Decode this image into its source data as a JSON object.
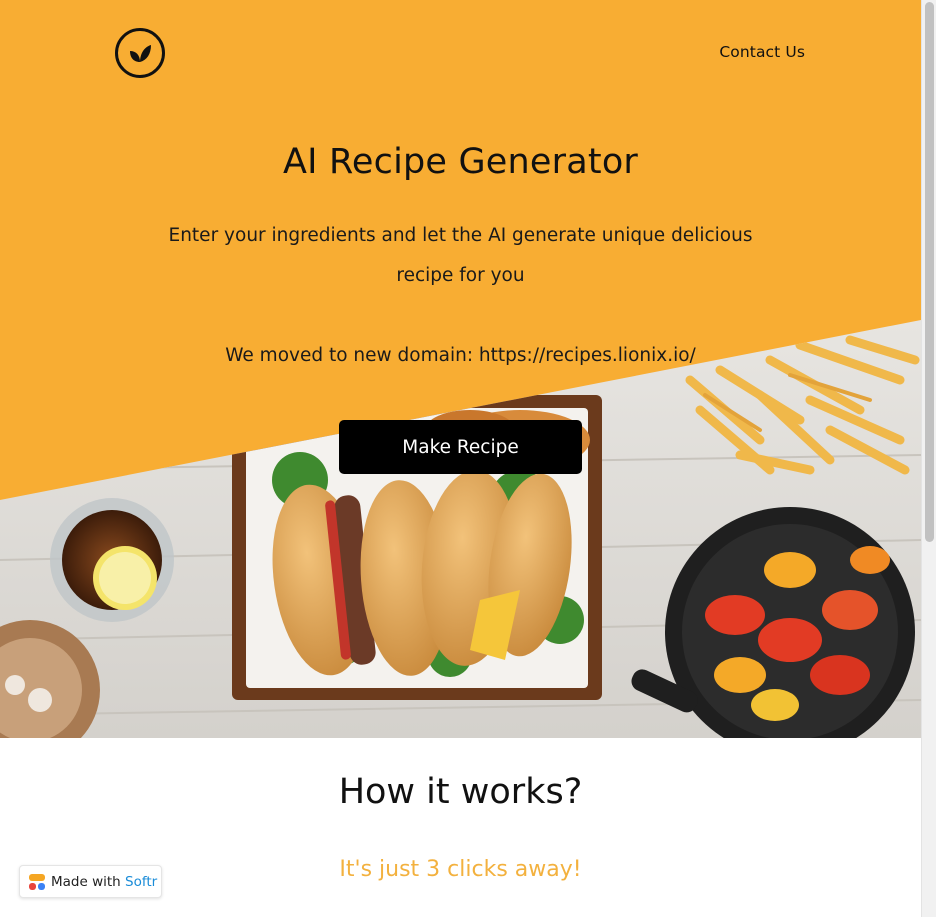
{
  "nav": {
    "logo_icon": "leaf-icon",
    "contact_label": "Contact Us"
  },
  "hero": {
    "title": "AI Recipe Generator",
    "subtitle": "Enter your ingredients and let the AI generate unique delicious recipe for you",
    "domain_note": "We moved to new domain: https://recipes.lionix.io/",
    "cta_label": "Make Recipe",
    "background_color": "#f8ad33",
    "photo": "food-table-photo"
  },
  "how": {
    "title": "How it works?",
    "subtitle": "It's just 3 clicks away!",
    "subtitle_color": "#f3b13e"
  },
  "badge": {
    "made_with": "Made with",
    "brand": "Softr",
    "brand_color": "#1a8cd8",
    "icon": "softr-logo-icon"
  }
}
